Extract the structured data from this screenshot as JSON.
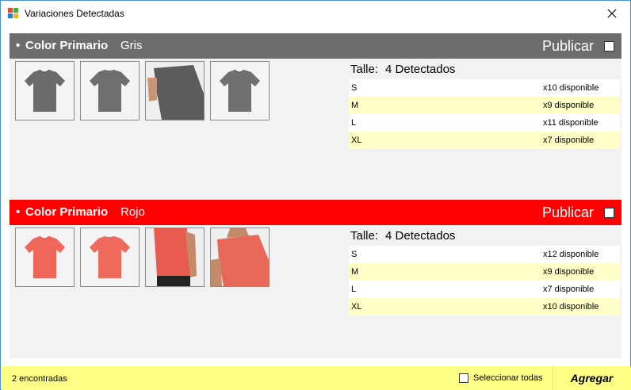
{
  "window": {
    "title": "Variaciones Detectadas",
    "close_icon": "close-icon"
  },
  "colors": {
    "gris_header": "#6d6d6d",
    "rojo_header": "#ff0000",
    "row_alt": "#ffffc8",
    "footer_bg": "#ffff88"
  },
  "variants": [
    {
      "label": "Color Primario",
      "value": "Gris",
      "publish_label": "Publicar",
      "publish_checked": false,
      "shirt_color": "#6b6b6b",
      "images": [
        "tshirt-front-gray",
        "tshirt-back-gray",
        "model-side-gray",
        "tshirt-front-gray-2"
      ],
      "sizes_label": "Talle:",
      "sizes_count": "4 Detectados",
      "sizes": [
        {
          "size": "S",
          "available": "x10 disponible"
        },
        {
          "size": "M",
          "available": "x9 disponible"
        },
        {
          "size": "L",
          "available": "x11 disponible"
        },
        {
          "size": "XL",
          "available": "x7 disponible"
        }
      ]
    },
    {
      "label": "Color Primario",
      "value": "Rojo",
      "publish_label": "Publicar",
      "publish_checked": false,
      "shirt_color": "#f0675a",
      "images": [
        "tshirt-front-red",
        "tshirt-back-red",
        "model-back-red",
        "model-side-red"
      ],
      "sizes_label": "Talle:",
      "sizes_count": "4 Detectados",
      "sizes": [
        {
          "size": "S",
          "available": "x12 disponible"
        },
        {
          "size": "M",
          "available": "x9 disponible"
        },
        {
          "size": "L",
          "available": "x7 disponible"
        },
        {
          "size": "XL",
          "available": "x10 disponible"
        }
      ]
    }
  ],
  "footer": {
    "found_text": "2 encontradas",
    "select_all_label": "Seleccionar todas",
    "select_all_checked": false,
    "add_button": "Agregar"
  }
}
